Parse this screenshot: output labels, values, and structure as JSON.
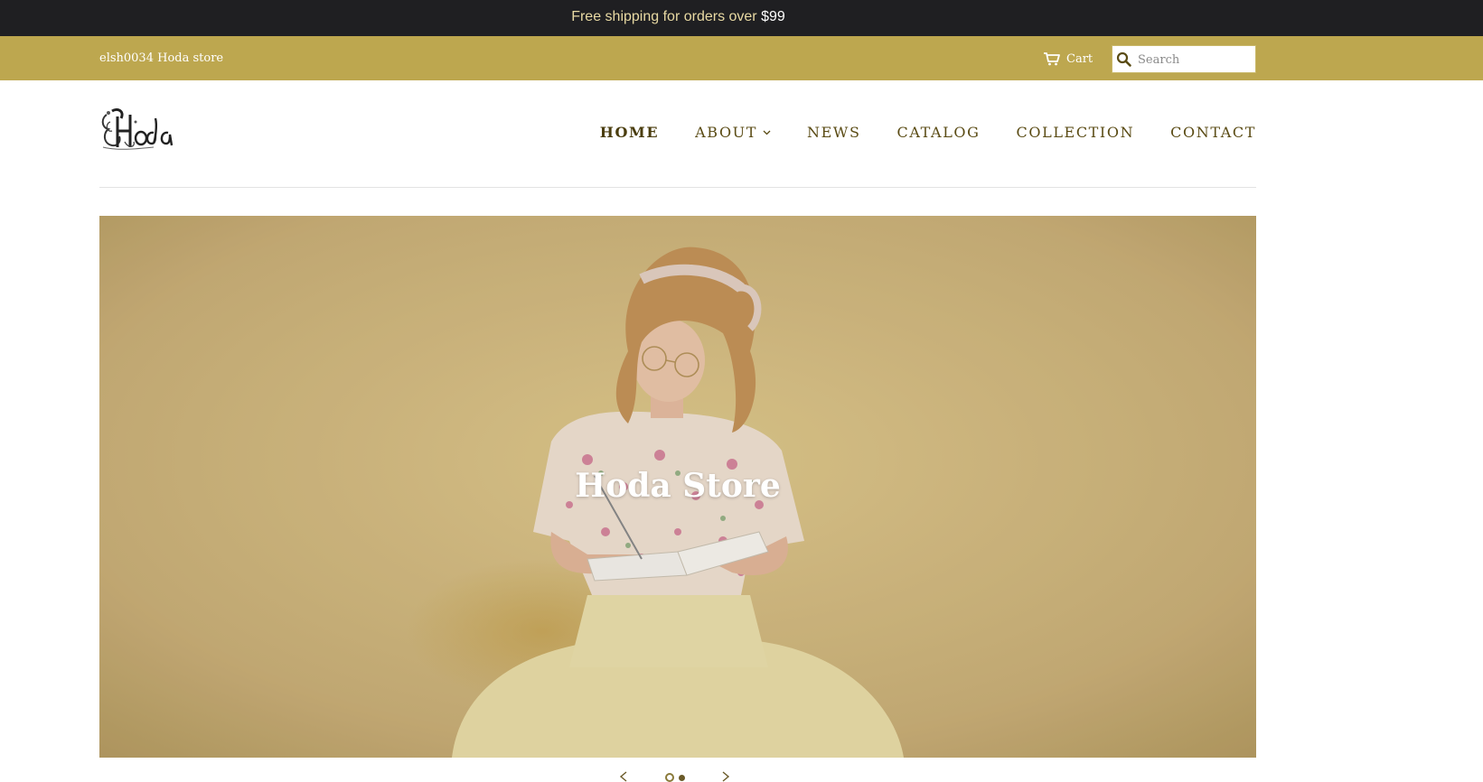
{
  "announcement": {
    "text": "Free shipping for orders over ",
    "amount": "$99"
  },
  "topbar": {
    "store_name": "elsh0034 Hoda store",
    "cart_label": "Cart",
    "search_placeholder": "Search"
  },
  "header": {
    "logo_text": "Hoda",
    "nav": [
      {
        "label": "HOME",
        "active": true
      },
      {
        "label": "ABOUT",
        "has_dropdown": true
      },
      {
        "label": "NEWS"
      },
      {
        "label": "CATALOG"
      },
      {
        "label": "COLLECTION"
      },
      {
        "label": "CONTACT"
      }
    ]
  },
  "hero": {
    "title": "Hoda Store",
    "slides_total": 2,
    "active_slide": 1
  },
  "colors": {
    "announcement_bg": "#1f1f22",
    "topbar_bg": "#bda74f",
    "nav_text": "#5a4b14",
    "hero_bg": "#cdb27a"
  }
}
